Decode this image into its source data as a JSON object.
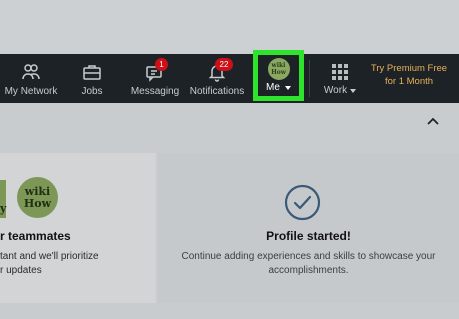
{
  "nav": {
    "items": [
      {
        "label": "My Network",
        "icon": "people-icon"
      },
      {
        "label": "Jobs",
        "icon": "briefcase-icon"
      },
      {
        "label": "Messaging",
        "icon": "messaging-icon",
        "badge": "1"
      },
      {
        "label": "Notifications",
        "icon": "bell-icon",
        "badge": "22"
      }
    ],
    "me": {
      "label": "Me",
      "avatar_top": "wiki",
      "avatar_bottom": "How"
    },
    "work": {
      "label": "Work"
    },
    "premium": {
      "line1": "Try Premium Free",
      "line2": "for 1 Month"
    }
  },
  "cards": {
    "left": {
      "logo_top": "wiki",
      "logo_bottom": "How",
      "logo_partial": "y",
      "title": "r teammates",
      "line1": "tant and we'll prioritize",
      "line2": "r updates"
    },
    "right": {
      "title": "Profile started!",
      "text": "Continue adding experiences and skills to showcase your accomplishments."
    }
  },
  "colors": {
    "navbar": "#1d2226",
    "highlight": "#2ee32c",
    "badge": "#cc1016",
    "premium_text": "#e7b05a",
    "check": "#3a5a78"
  }
}
